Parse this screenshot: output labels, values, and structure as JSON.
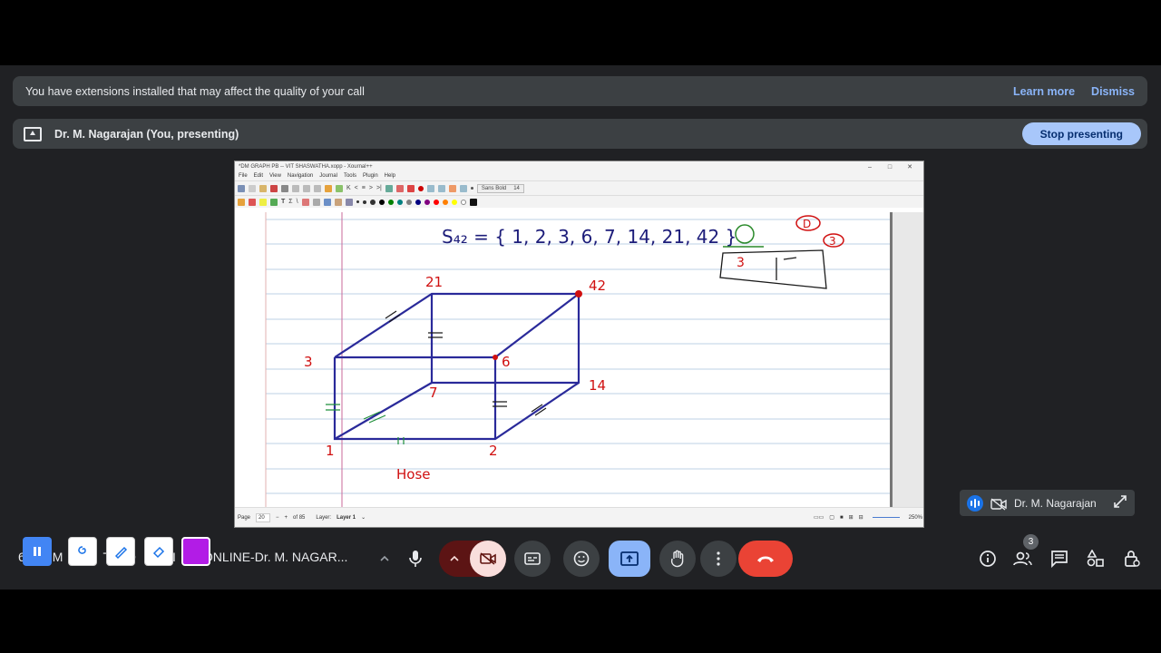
{
  "extension_banner": {
    "message": "You have extensions installed that may affect the quality of your call",
    "learn_more": "Learn more",
    "dismiss": "Dismiss"
  },
  "presenting_banner": {
    "presenter": "Dr. M. Nagarajan (You, presenting)",
    "stop_label": "Stop presenting"
  },
  "shared_window": {
    "title": "*DM GRAPH PB -- VIT SHASWATHA.xopp - Xournal++",
    "menus": [
      "File",
      "Edit",
      "View",
      "Navigation",
      "Journal",
      "Tools",
      "Plugin",
      "Help"
    ],
    "font": "Sans Bold",
    "font_size": "14",
    "status": {
      "page_label": "Page",
      "page_value": "20",
      "page_of": "of 85",
      "layer_label": "Layer:",
      "layer_value": "Layer 1",
      "zoom": "250%"
    },
    "pen_colors": [
      "#000000",
      "#008000",
      "#008080",
      "#808080",
      "#000080",
      "#800080",
      "#ff0000",
      "#ff8000",
      "#ffff00",
      "#ffffff"
    ],
    "handwriting": {
      "set": "S₄₂ = { 1, 2, 3, 6, 7, 14, 21, 42 }",
      "marks": [
        "D",
        "3"
      ],
      "boxed": "3",
      "vertices": [
        "21",
        "42",
        "3",
        "6",
        "7",
        "14",
        "1",
        "2"
      ],
      "caption": "Hose"
    }
  },
  "self_tile": {
    "name": "Dr. M. Nagarajan"
  },
  "meeting": {
    "title_left": "6",
    "title_mid_1": "M",
    "title_mid_2": "T",
    "title_mid_3": "O",
    "title_mid_4": "UI",
    "title_right": "ONLINE-Dr. M. NAGAR..."
  },
  "participants_count": "3",
  "colors": {
    "accent": "#8ab4f8",
    "stop_button": "#a8c7fa",
    "end_call": "#ea4335",
    "camera_off": "#f9dedc",
    "present_active": "#8ab4f8",
    "annotation_color": "#b21ce6"
  }
}
